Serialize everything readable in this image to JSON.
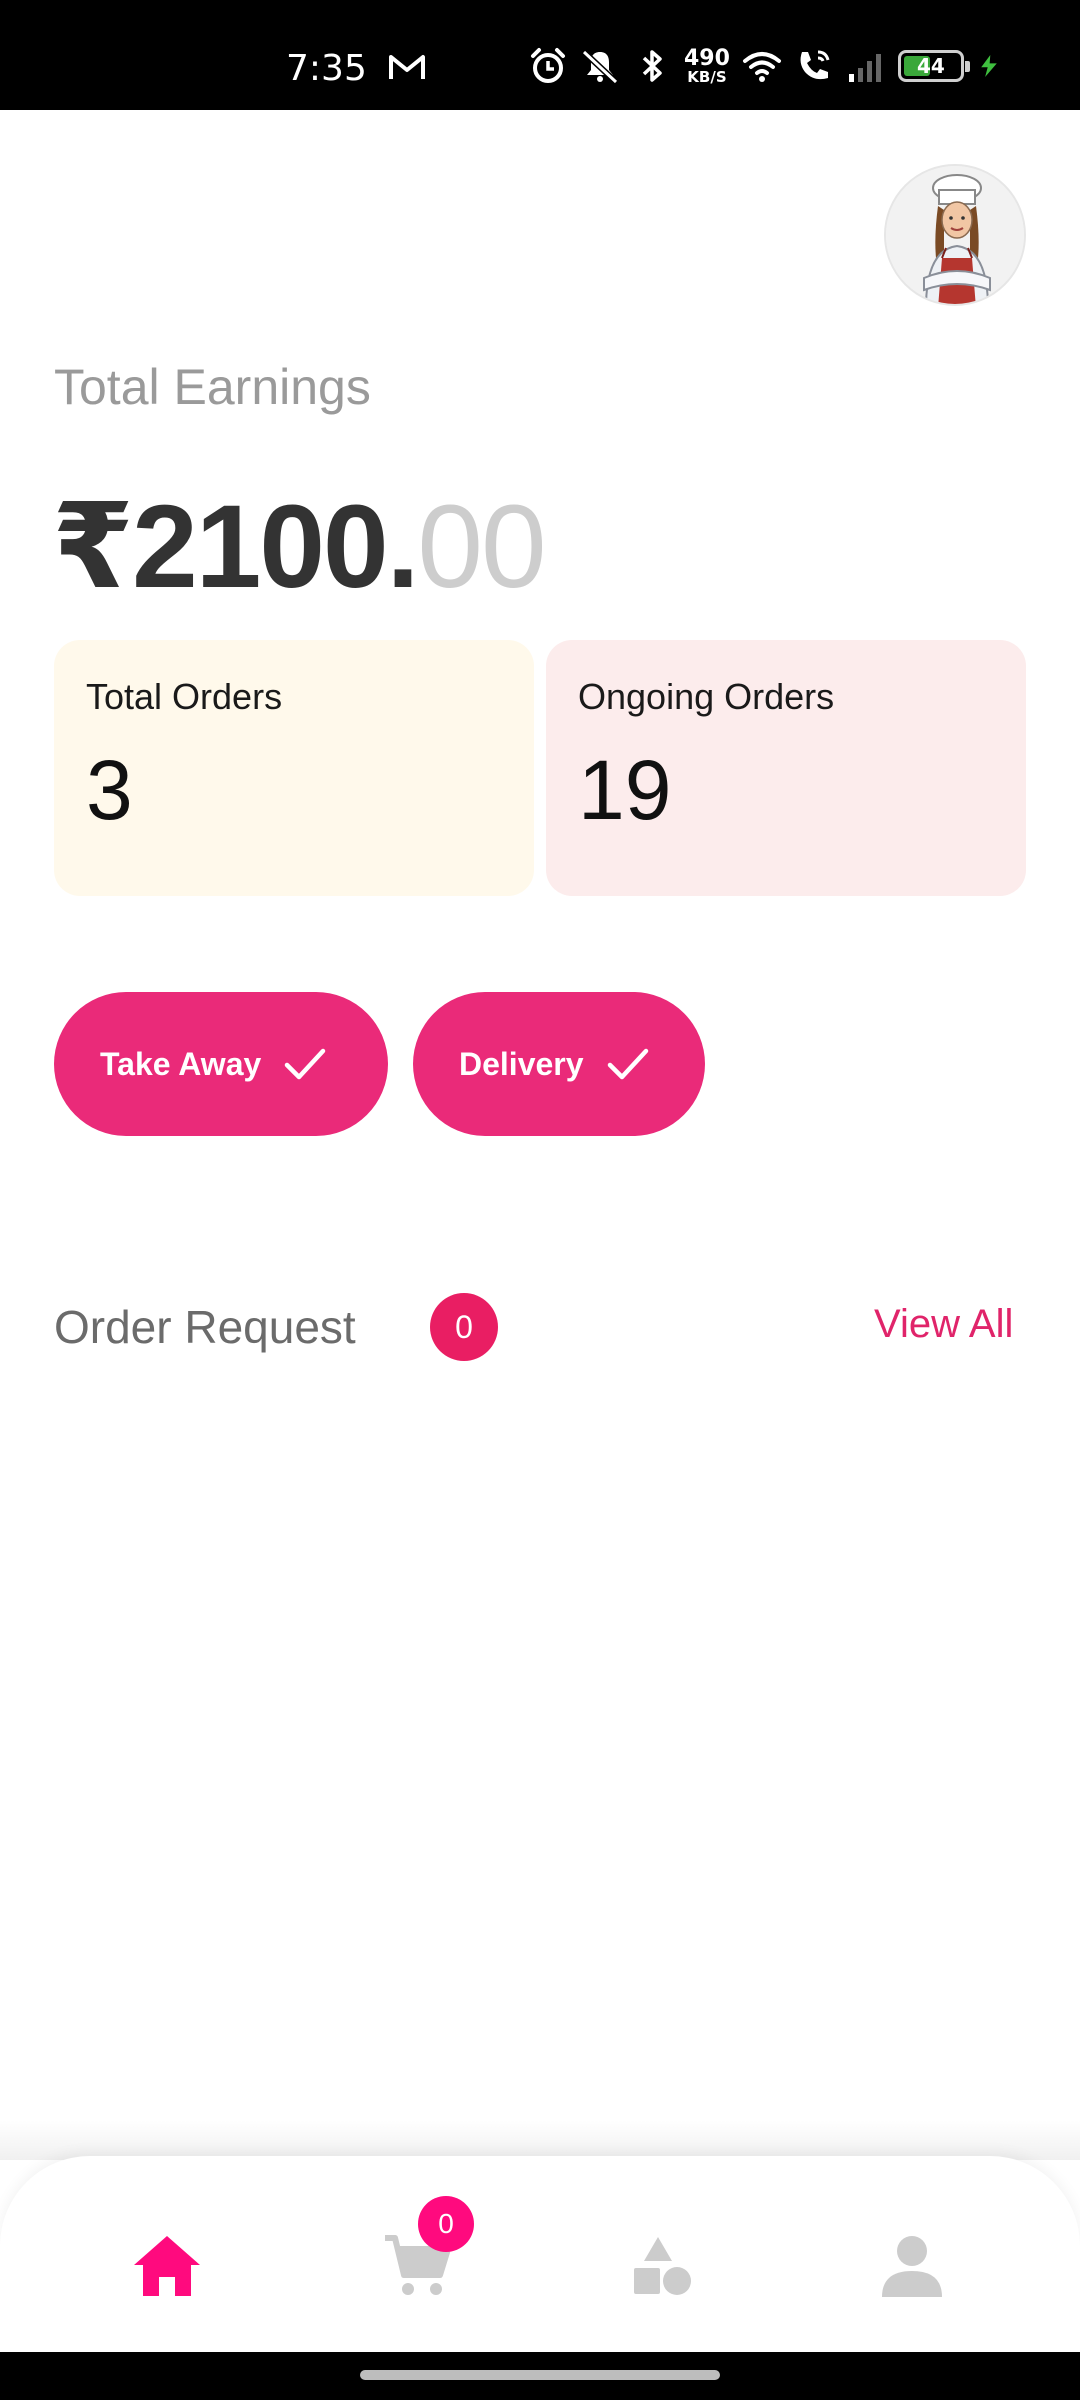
{
  "status_bar": {
    "time": "7:35",
    "net_speed_value": "490",
    "net_speed_unit": "KB/S",
    "battery_level": "44",
    "icons": [
      "gmail-icon",
      "alarm-icon",
      "vibrate-off-icon",
      "bluetooth-icon",
      "wifi-icon",
      "wifi-calling-icon",
      "signal-icon",
      "battery-icon",
      "charging-icon"
    ]
  },
  "header": {
    "avatar_icon": "chef-avatar"
  },
  "earnings": {
    "label": "Total Earnings",
    "amount_integer": "₹2100.",
    "amount_decimal": "00"
  },
  "stats": {
    "total_orders_label": "Total Orders",
    "total_orders_value": "3",
    "ongoing_orders_label": "Ongoing Orders",
    "ongoing_orders_value": "19"
  },
  "modes": {
    "takeaway_label": "Take Away",
    "delivery_label": "Delivery"
  },
  "order_request": {
    "title": "Order Request",
    "count": "0",
    "view_all": "View All"
  },
  "bottom_nav": {
    "cart_badge": "0",
    "active": "home",
    "items": [
      "home-icon",
      "cart-icon",
      "categories-icon",
      "profile-icon"
    ]
  },
  "colors": {
    "accent": "#EA2A79",
    "badge": "#E91E63",
    "nav_active": "#FF0A7E",
    "nav_inactive": "#CCCCCC",
    "total_card_bg": "#FFF9EB",
    "ongoing_card_bg": "#FCECEC"
  }
}
